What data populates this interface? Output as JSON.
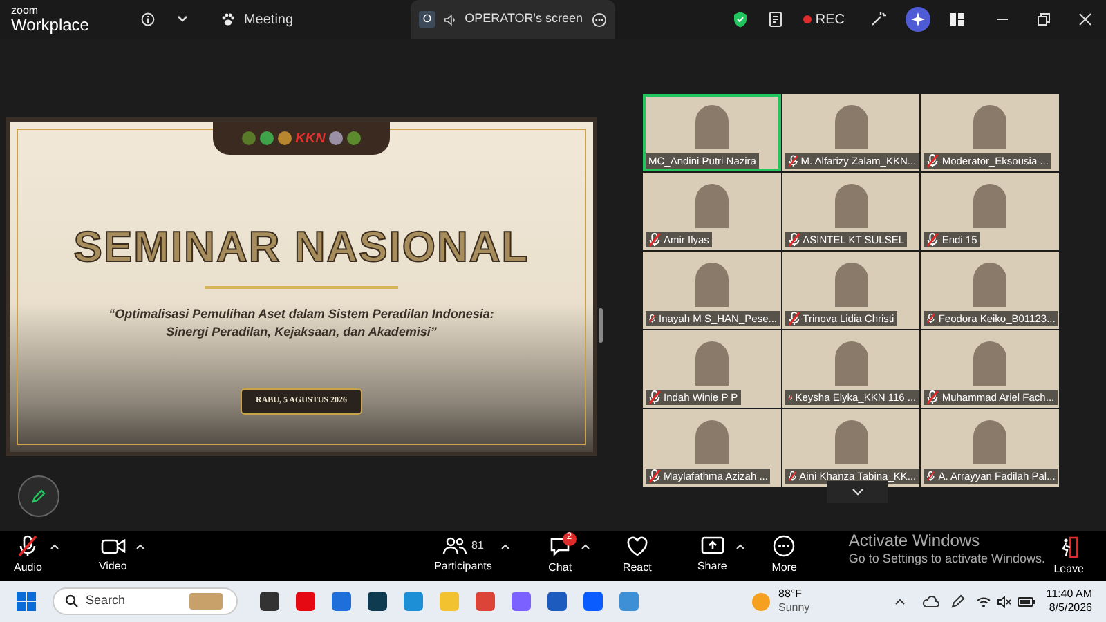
{
  "title_bar": {
    "logo_top": "zoom",
    "logo_bottom": "Workplace",
    "meeting_label": "Meeting",
    "share_tab": {
      "badge": "O",
      "label": "OPERATOR's screen"
    },
    "recording": "REC"
  },
  "slide": {
    "logo_text": "KKN",
    "title": "SEMINAR NASIONAL",
    "subtitle_line_1": "“Optimalisasi Pemulihan Aset dalam Sistem Peradilan Indonesia:",
    "subtitle_line_2": "Sinergi Peradilan, Kejaksaan, dan Akademisi”",
    "date": "RABU, 5 AGUSTUS 2026"
  },
  "participants": [
    {
      "name": "MC_Andini Putri Nazira",
      "muted": false,
      "speaking": true
    },
    {
      "name": "M. Alfarizy Zalam_KKN...",
      "muted": true,
      "speaking": false
    },
    {
      "name": "Moderator_Eksousia ...",
      "muted": true,
      "speaking": false
    },
    {
      "name": "Amir Ilyas",
      "muted": true,
      "speaking": false
    },
    {
      "name": "ASINTEL KT SULSEL",
      "muted": true,
      "speaking": false
    },
    {
      "name": "Endi 15",
      "muted": true,
      "speaking": false
    },
    {
      "name": "Inayah M S_HAN_Pese...",
      "muted": true,
      "speaking": false
    },
    {
      "name": "Trinova Lidia Christi",
      "muted": true,
      "speaking": false
    },
    {
      "name": "Feodora Keiko_B01123...",
      "muted": true,
      "speaking": false
    },
    {
      "name": "Indah Winie P P",
      "muted": true,
      "speaking": false
    },
    {
      "name": "Keysha Elyka_KKN 116 ...",
      "muted": true,
      "speaking": false
    },
    {
      "name": "Muhammad Ariel Fach...",
      "muted": true,
      "speaking": false
    },
    {
      "name": "Maylafathma Azizah ...",
      "muted": true,
      "speaking": false
    },
    {
      "name": "Aini Khanza Tabina_KK...",
      "muted": true,
      "speaking": false
    },
    {
      "name": "A. Arrayyan Fadilah Pal...",
      "muted": true,
      "speaking": false
    }
  ],
  "toolbar": {
    "items": [
      {
        "kind": "audio",
        "label": "Audio",
        "muted": true
      },
      {
        "kind": "video",
        "label": "Video"
      },
      {
        "kind": "participants",
        "label": "Participants",
        "count": "81"
      },
      {
        "kind": "chat",
        "label": "Chat",
        "badge": "2"
      },
      {
        "kind": "react",
        "label": "React"
      },
      {
        "kind": "share",
        "label": "Share"
      },
      {
        "kind": "more",
        "label": "More"
      }
    ],
    "leave": "Leave"
  },
  "activation_notice": {
    "title": "Activate Windows",
    "text": "Go to Settings to activate Windows."
  },
  "taskbar": {
    "search_placeholder": "Search",
    "weather": {
      "temperature": "88°F",
      "condition": "Sunny"
    },
    "time": "11:40 AM",
    "date": "8/5/2026"
  }
}
